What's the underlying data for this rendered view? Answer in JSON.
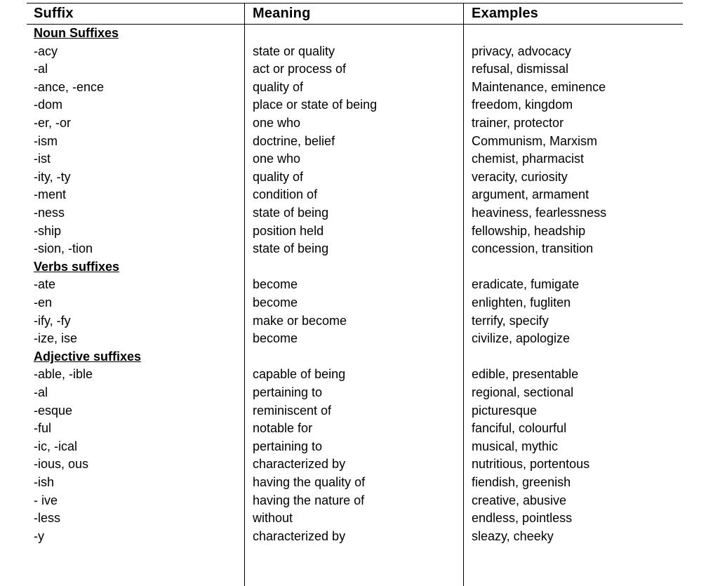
{
  "table": {
    "headers": [
      "Suffix",
      "Meaning",
      "Examples"
    ],
    "sections": [
      {
        "title": "Noun Suffixes",
        "rows": [
          [
            "-acy",
            "state or quality",
            "privacy, advocacy"
          ],
          [
            "-al",
            "act or process of",
            "refusal, dismissal"
          ],
          [
            "-ance, -ence",
            "quality of",
            "Maintenance, eminence"
          ],
          [
            "-dom",
            "place or state of being",
            "freedom, kingdom"
          ],
          [
            "-er, -or",
            "one who",
            "trainer, protector"
          ],
          [
            "-ism",
            "doctrine, belief",
            "Communism, Marxism"
          ],
          [
            "-ist",
            "one who",
            "chemist, pharmacist"
          ],
          [
            "-ity, -ty",
            "quality of",
            "veracity, curiosity"
          ],
          [
            "-ment",
            "condition of",
            "argument, armament"
          ],
          [
            "-ness",
            "state of being",
            "heaviness, fearlessness"
          ],
          [
            "-ship",
            "position held",
            "fellowship, headship"
          ],
          [
            "-sion, -tion",
            "state of being",
            "concession, transition"
          ]
        ]
      },
      {
        "title": "Verbs suffixes",
        "rows": [
          [
            "-ate",
            "become",
            "eradicate, fumigate"
          ],
          [
            "-en",
            "become",
            "enlighten, fugliten"
          ],
          [
            "-ify, -fy",
            "make or become",
            "terrify, specify"
          ],
          [
            "-ize, ise",
            "become",
            "civilize, apologize"
          ]
        ]
      },
      {
        "title": "Adjective suffixes",
        "rows": [
          [
            "-able, -ible",
            "capable of being",
            "edible, presentable"
          ],
          [
            "-al",
            "pertaining to",
            "regional, sectional"
          ],
          [
            "-esque",
            "reminiscent of",
            "picturesque"
          ],
          [
            "-ful",
            "notable for",
            "fanciful, colourful"
          ],
          [
            "-ic, -ical",
            "pertaining to",
            "musical, mythic"
          ],
          [
            "-ious, ous",
            "characterized by",
            "nutritious, portentous"
          ],
          [
            "-ish",
            "having the quality of",
            "fiendish, greenish"
          ],
          [
            "- ive",
            "having the nature of",
            "creative, abusive"
          ],
          [
            "-less",
            "without",
            "endless, pointless"
          ],
          [
            "-y",
            "characterized by",
            "sleazy, cheeky"
          ]
        ]
      }
    ]
  }
}
